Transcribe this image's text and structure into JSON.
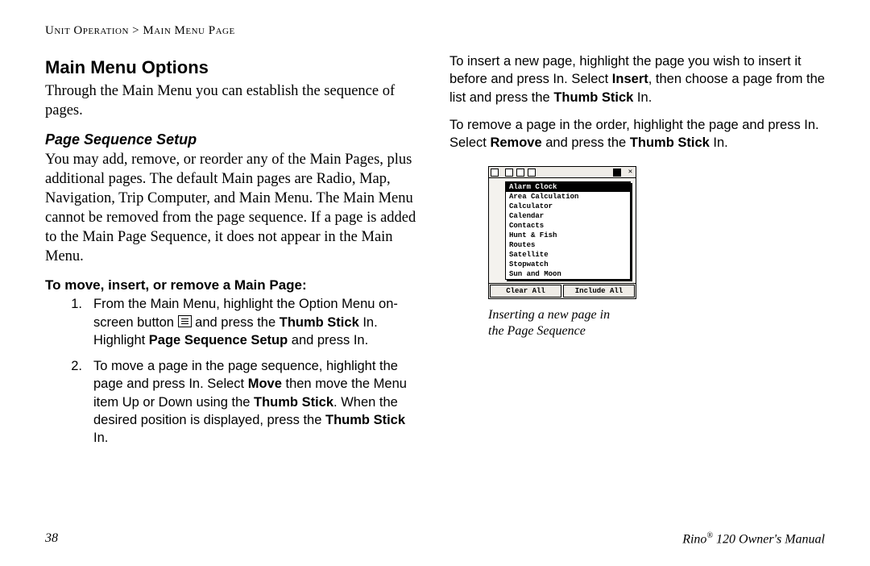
{
  "breadcrumb": {
    "section": "Unit Operation",
    "sep": " > ",
    "page": "Main Menu Page"
  },
  "left": {
    "heading": "Main Menu Options",
    "intro": "Through the Main Menu you can establish the sequence of pages.",
    "sub_heading": "Page Sequence Setup",
    "sub_body": "You may add, remove, or reorder any of the Main Pages, plus additional pages. The default Main pages are Radio, Map, Navigation, Trip Computer, and Main Menu. The Main Menu cannot be removed from the page sequence. If a page is added to the Main Page Sequence, it does not appear in the Main Menu.",
    "step_heading": "To move, insert, or remove a Main Page:",
    "steps": {
      "s1": {
        "num": "1.",
        "a": "From the Main Menu, highlight the Option Menu on-screen button ",
        "b": " and press the ",
        "c": "Thumb Stick",
        "d": " In. Highlight ",
        "e": "Page Sequence Setup",
        "f": " and press In."
      },
      "s2": {
        "num": "2.",
        "a": "To move a page in the page sequence, highlight the page and press In. Select ",
        "b": "Move",
        "c": " then move the Menu item Up or Down using the ",
        "d": "Thumb Stick",
        "e": ". When the desired position is displayed, press the ",
        "f": "Thumb Stick",
        "g": " In."
      }
    }
  },
  "right": {
    "p1": {
      "a": "To insert a new page, highlight the page you wish to insert it before and press In. Select ",
      "b": "Insert",
      "c": ", then choose a page from the list and press the ",
      "d": "Thumb Stick",
      "e": " In."
    },
    "p2": {
      "a": "To remove a page in the order, highlight the page and press In. Select ",
      "b": "Remove",
      "c": " and press the ",
      "d": "Thumb Stick",
      "e": " In."
    },
    "figure": {
      "popup_items": [
        "Alarm Clock",
        "Area Calculation",
        "Calculator",
        "Calendar",
        "Contacts",
        "Hunt & Fish",
        "Routes",
        "Satellite",
        "Stopwatch",
        "Sun and Moon"
      ],
      "buttons": {
        "left": "Clear All",
        "right": "Include All"
      },
      "caption_l1": "Inserting a new page in",
      "caption_l2": "the Page Sequence"
    }
  },
  "footer": {
    "page_number": "38",
    "manual_a": "Rino",
    "manual_sup": "®",
    "manual_b": " 120 Owner's Manual"
  }
}
